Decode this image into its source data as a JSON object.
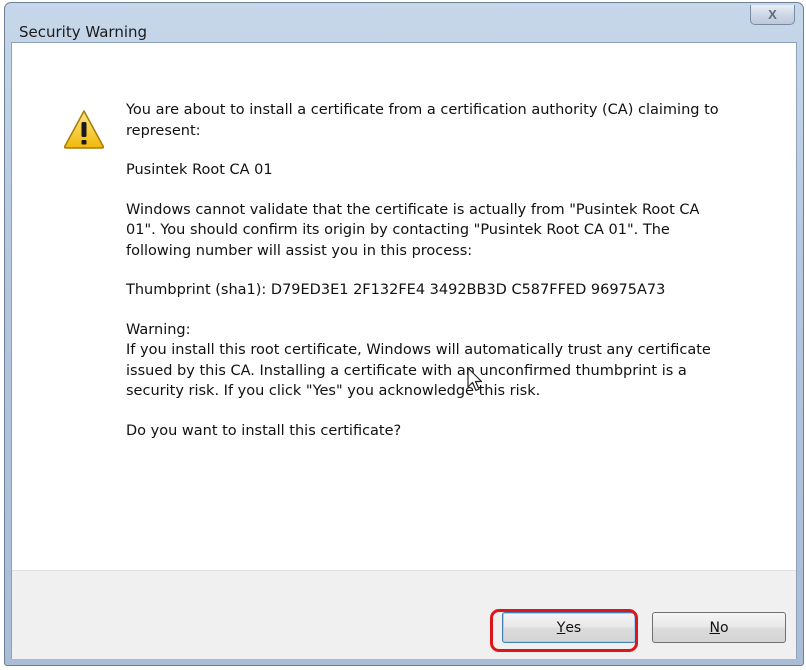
{
  "window": {
    "title": "Security Warning",
    "close_glyph": "X"
  },
  "message": {
    "intro": "You are about to install a certificate from a certification authority (CA) claiming to represent:",
    "ca_name": "Pusintek Root CA 01",
    "validation": "Windows cannot validate that the certificate is actually from \"Pusintek Root CA 01\". You should confirm its origin by contacting \"Pusintek Root CA 01\". The following number will assist you in this process:",
    "thumbprint": "Thumbprint (sha1): D79ED3E1 2F132FE4 3492BB3D C587FFED 96975A73",
    "warning_heading": "Warning:",
    "warning_body": "If you install this root certificate, Windows will automatically trust any certificate issued by this CA. Installing a certificate with an unconfirmed thumbprint is a security risk. If you click \"Yes\" you acknowledge this risk.",
    "question": "Do you want to install this certificate?"
  },
  "buttons": {
    "yes": {
      "mnemonic": "Y",
      "rest": "es"
    },
    "no": {
      "mnemonic": "N",
      "rest": "o"
    }
  },
  "icons": {
    "warning": "warning-icon",
    "cursor": "mouse-cursor-icon"
  },
  "colors": {
    "highlight": "#e0141b",
    "warning_yellow": "#f5c518"
  }
}
